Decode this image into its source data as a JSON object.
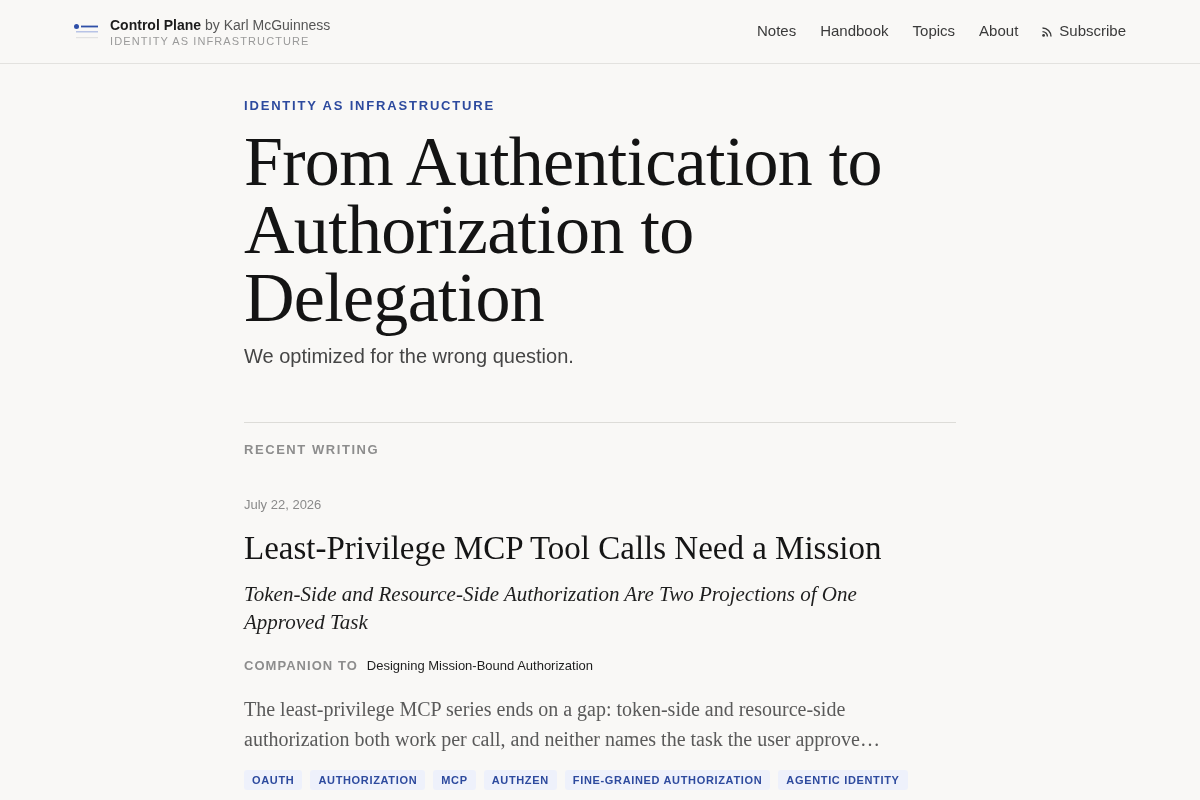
{
  "header": {
    "site_name": "Control Plane",
    "byline": "by Karl McGuinness",
    "tagline": "IDENTITY AS INFRASTRUCTURE",
    "nav": [
      {
        "label": "Notes",
        "kind": "link"
      },
      {
        "label": "Handbook",
        "kind": "link"
      },
      {
        "label": "Topics",
        "kind": "link"
      },
      {
        "label": "About",
        "kind": "link"
      },
      {
        "label": "Subscribe",
        "kind": "feed"
      }
    ]
  },
  "hero": {
    "eyebrow": "IDENTITY AS INFRASTRUCTURE",
    "title": "From Authentication to Authorization to Delegation",
    "subtitle": "We optimized for the wrong question."
  },
  "recent": {
    "heading": "RECENT WRITING",
    "posts": [
      {
        "date": "July 22, 2026",
        "title": "Least-Privilege MCP Tool Calls Need a Mission",
        "subtitle": "Token-Side and Resource-Side Authorization Are Two Projections of One Approved Task",
        "companion_label": "COMPANION TO",
        "companion_title": "Designing Mission-Bound Authorization",
        "excerpt": "The least-privilege MCP series ends on a gap: token-side and resource-side authorization both work per call, and neither names the task the user approve…",
        "tags": [
          "OAUTH",
          "AUTHORIZATION",
          "MCP",
          "AUTHZEN",
          "FINE-GRAINED AUTHORIZATION",
          "AGENTIC IDENTITY"
        ]
      }
    ]
  }
}
